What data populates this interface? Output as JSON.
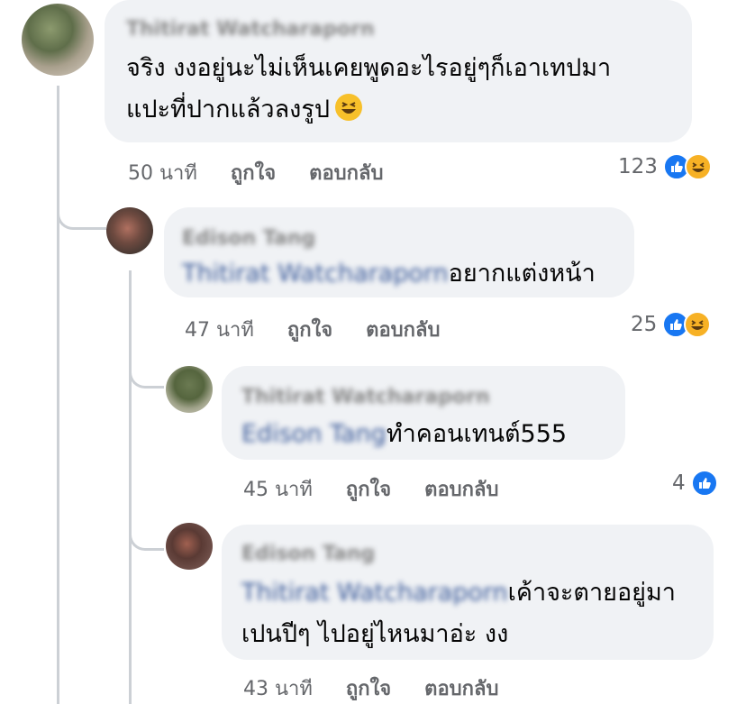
{
  "comments": [
    {
      "author": "Thitirat Watcharaporn",
      "lines": [
        "จริง งงอยู่นะไม่เห็นเคยพูดอะไรอยู่ๆก็เอาเทปมา",
        "แปะที่ปากแล้วลงรูป"
      ],
      "emoji": "😆",
      "time": "50 นาที",
      "like_label": "ถูกใจ",
      "reply_label": "ตอบกลับ",
      "reaction_count": "123",
      "reactions": [
        "like-icon",
        "haha-icon"
      ]
    },
    {
      "author": "Edison Tang",
      "mention": "Thitirat Watcharaporn",
      "text": "อยากแต่งหน้า",
      "time": "47 นาที",
      "like_label": "ถูกใจ",
      "reply_label": "ตอบกลับ",
      "reaction_count": "25",
      "reactions": [
        "like-icon",
        "haha-icon"
      ]
    },
    {
      "author": "Thitirat Watcharaporn",
      "mention": "Edison Tang",
      "text": "ทำคอนเทนต์555",
      "time": "45 นาที",
      "like_label": "ถูกใจ",
      "reply_label": "ตอบกลับ",
      "reaction_count": "4",
      "reactions": [
        "like-icon"
      ]
    },
    {
      "author": "Edison Tang",
      "mention": "Thitirat Watcharaporn",
      "lines": [
        "เค้าจะตายอยู่มา",
        "เปนปีๆ ไปอยู่ไหนมาอ่ะ งง"
      ],
      "time": "43 นาที",
      "like_label": "ถูกใจ",
      "reply_label": "ตอบกลับ"
    }
  ],
  "colors": {
    "bubble": "#f0f2f5",
    "like": "#1877f2",
    "haha": "#f7b125",
    "meta": "#65676b"
  }
}
